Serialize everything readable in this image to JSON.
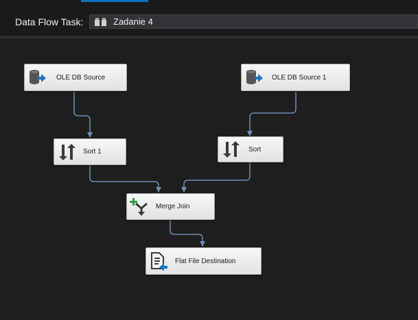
{
  "toolbar": {
    "task_label": "Data Flow Task:",
    "task_value": "Zadanie 4"
  },
  "nodes": {
    "ole_db_source": "OLE DB Source",
    "ole_db_source_1": "OLE DB Source 1",
    "sort_1": "Sort 1",
    "sort": "Sort",
    "merge_join": "Merge Join",
    "flat_file_destination": "Flat File Destination"
  },
  "colors": {
    "canvas": "#1e1e1e",
    "connector": "#6d8fb5",
    "accent": "#0e70c0",
    "node_fill": "#f0f0f0"
  }
}
